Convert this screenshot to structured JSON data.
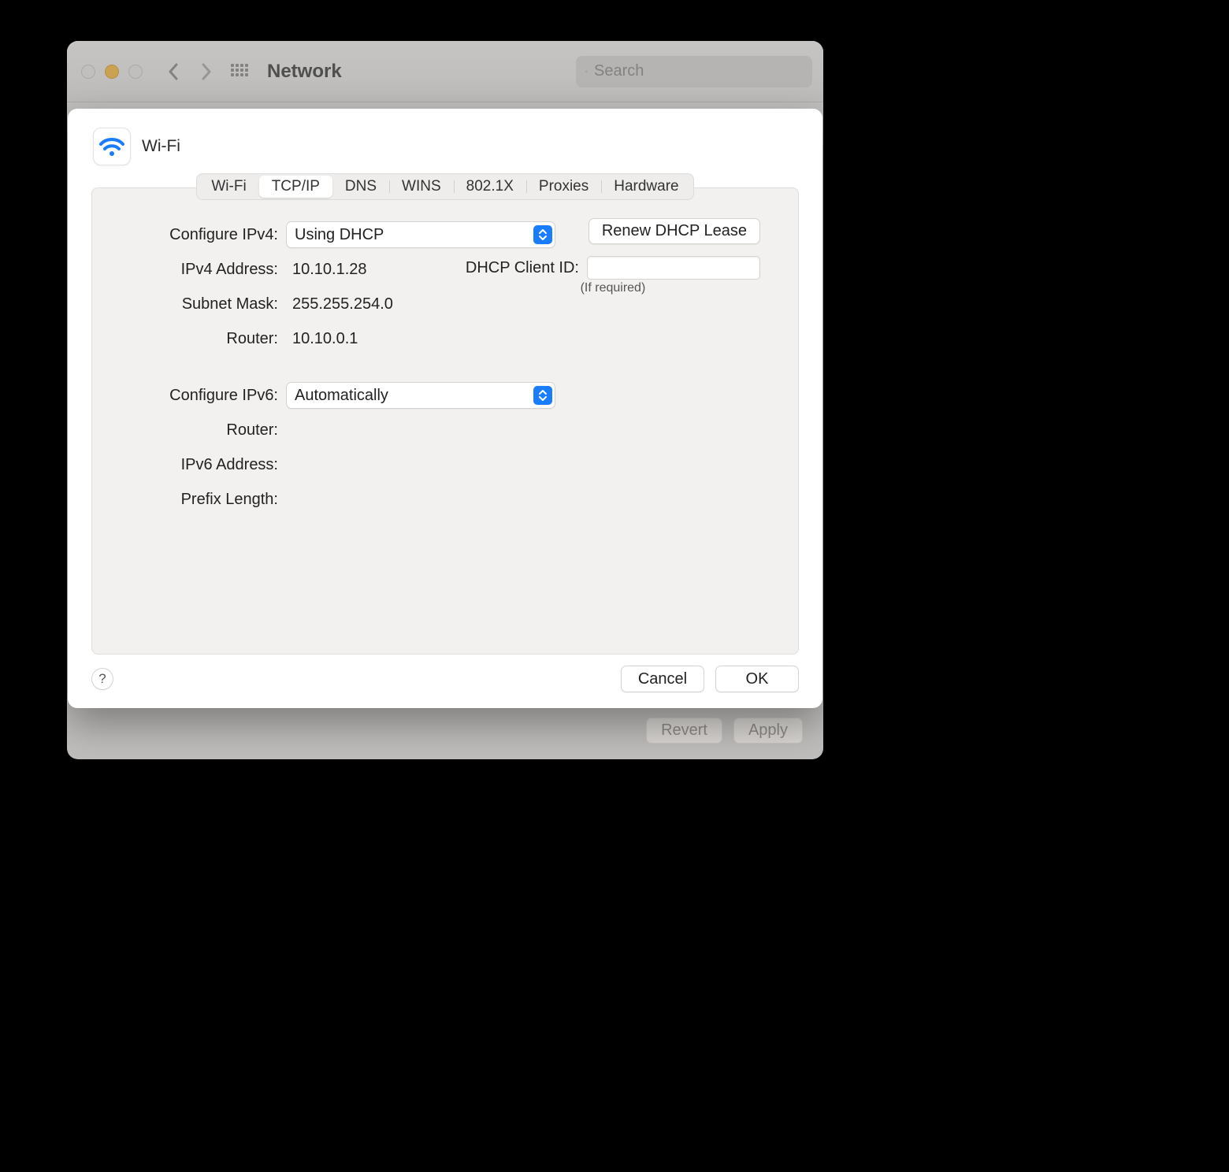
{
  "window": {
    "title": "Network",
    "search_placeholder": "Search",
    "back_buttons": {
      "revert": "Revert",
      "apply": "Apply"
    }
  },
  "sheet": {
    "interface_name": "Wi-Fi",
    "tabs": [
      "Wi-Fi",
      "TCP/IP",
      "DNS",
      "WINS",
      "802.1X",
      "Proxies",
      "Hardware"
    ],
    "active_tab_index": 1,
    "labels": {
      "configure_ipv4": "Configure IPv4:",
      "ipv4_address": "IPv4 Address:",
      "subnet_mask": "Subnet Mask:",
      "router": "Router:",
      "configure_ipv6": "Configure IPv6:",
      "router6": "Router:",
      "ipv6_address": "IPv6 Address:",
      "prefix_length": "Prefix Length:",
      "dhcp_client_id": "DHCP Client ID:",
      "if_required": "(If required)"
    },
    "values": {
      "configure_ipv4": "Using DHCP",
      "ipv4_address": "10.10.1.28",
      "subnet_mask": "255.255.254.0",
      "router": "10.10.0.1",
      "configure_ipv6": "Automatically",
      "router6": "",
      "ipv6_address": "",
      "prefix_length": "",
      "dhcp_client_id": ""
    },
    "buttons": {
      "renew_dhcp": "Renew DHCP Lease",
      "cancel": "Cancel",
      "ok": "OK",
      "help": "?"
    }
  }
}
